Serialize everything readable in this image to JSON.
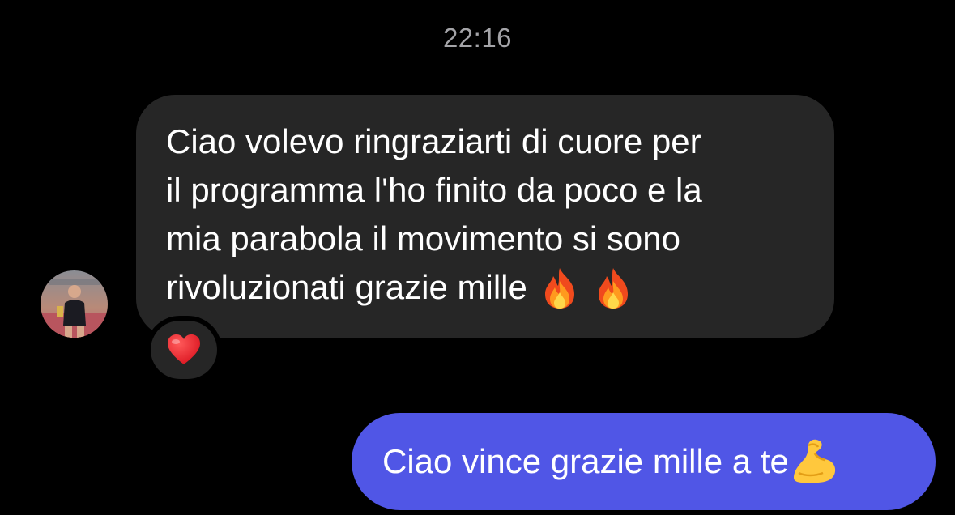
{
  "conversation": {
    "timestamp": "22:16",
    "incoming_message": {
      "lines": [
        "Ciao volevo ringraziarti di cuore per",
        "il programma l'ho finito da poco e la",
        "mia parabola il movimento si sono",
        "rivoluzionati grazie mille"
      ],
      "trailing_emoji": [
        "fire-emoji",
        "fire-emoji"
      ],
      "reaction": "heart-emoji",
      "bubble_color": "#262626"
    },
    "outgoing_message": {
      "text": "Ciao vince grazie mille a te",
      "trailing_emoji": "flexed-biceps-emoji",
      "bubble_color": "#5056e6"
    }
  },
  "colors": {
    "background": "#000000",
    "timestamp": "#a4a4a8",
    "message_text": "#ffffff"
  }
}
